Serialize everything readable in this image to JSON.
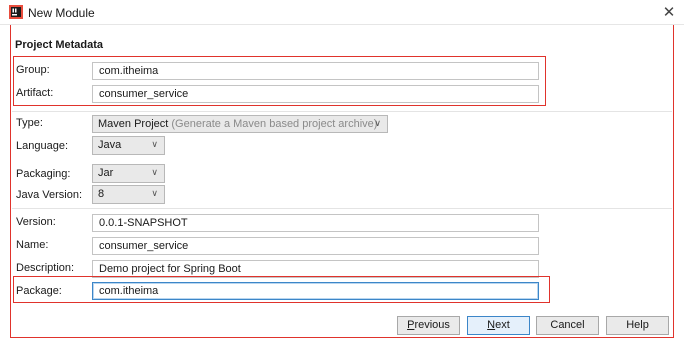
{
  "window": {
    "title": "New Module"
  },
  "section": {
    "title": "Project Metadata"
  },
  "fields": {
    "group": {
      "label": "Group:",
      "value": "com.itheima"
    },
    "artifact": {
      "label": "Artifact:",
      "value": "consumer_service"
    },
    "type": {
      "label": "Type:",
      "value": "Maven Project",
      "hint": "(Generate a Maven based project archive)"
    },
    "language": {
      "label": "Language:",
      "value": "Java"
    },
    "packaging": {
      "label": "Packaging:",
      "value": "Jar"
    },
    "java_version": {
      "label": "Java Version:",
      "value": "8"
    },
    "version": {
      "label": "Version:",
      "value": "0.0.1-SNAPSHOT"
    },
    "name": {
      "label": "Name:",
      "value": "consumer_service"
    },
    "description": {
      "label": "Description:",
      "value": "Demo project for Spring Boot"
    },
    "package": {
      "label": "Package:",
      "value": "com.itheima"
    }
  },
  "buttons": {
    "previous": {
      "mnemonic": "P",
      "rest": "revious"
    },
    "next": {
      "mnemonic": "N",
      "rest": "ext"
    },
    "cancel": "Cancel",
    "help": "Help"
  },
  "colors": {
    "highlight_box": "#e0332c",
    "focus_border": "#3c86c8"
  }
}
